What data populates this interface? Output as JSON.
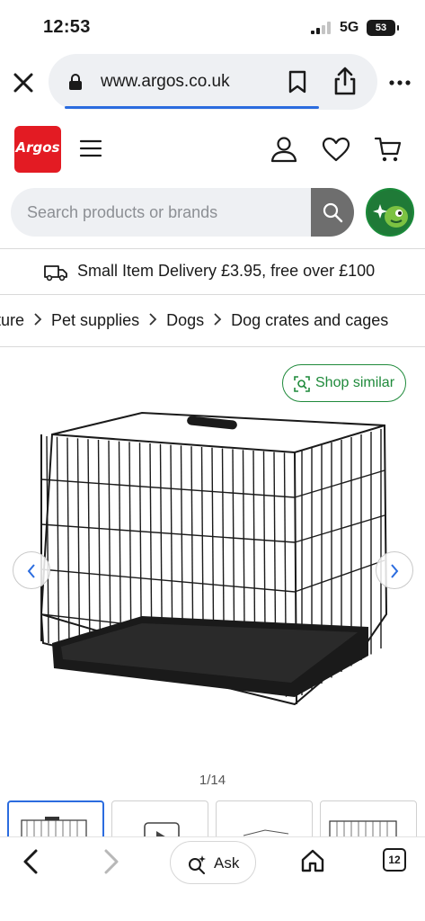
{
  "status_bar": {
    "time": "12:53",
    "network": "5G",
    "battery": "53"
  },
  "browser": {
    "url": "www.argos.co.uk",
    "tab_count": "12",
    "ask_label": "Ask",
    "load_progress": 0.76
  },
  "site": {
    "logo_text": "Argos",
    "brand_color": "#e31b23",
    "search_placeholder": "Search products or brands"
  },
  "delivery_banner": "Small Item Delivery £3.95, free over £100",
  "breadcrumb": [
    "niture",
    "Pet supplies",
    "Dogs",
    "Dog crates and cages"
  ],
  "gallery": {
    "shop_similar_label": "Shop similar",
    "counter": "1/14",
    "thumbnail_count": 4,
    "accent_color": "#1f8a3b"
  },
  "icons": {
    "close": "close-icon",
    "lock": "lock-icon",
    "bookmark": "bookmark-icon",
    "share": "share-icon",
    "more": "more-icon",
    "menu": "menu-icon",
    "account": "account-icon",
    "wishlist": "heart-icon",
    "cart": "cart-icon",
    "search": "search-icon",
    "van": "delivery-van-icon",
    "home": "home-icon",
    "back": "back-icon",
    "forward": "forward-icon"
  }
}
